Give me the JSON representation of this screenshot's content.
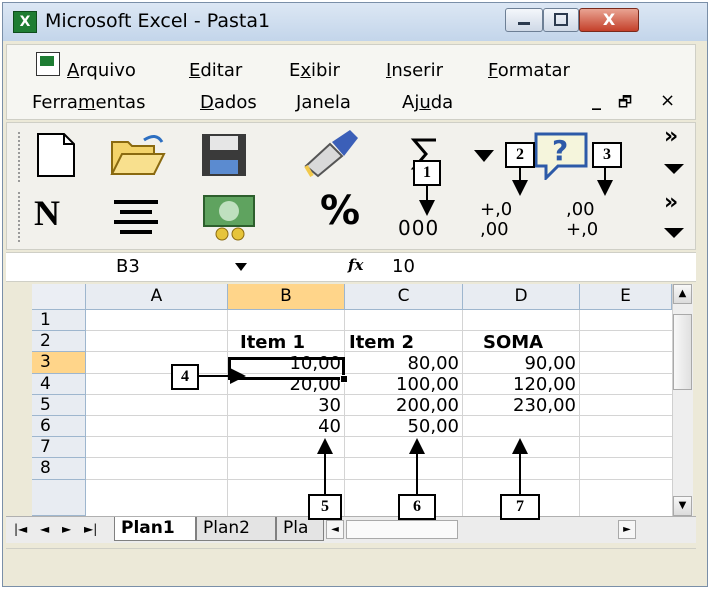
{
  "window": {
    "title": "Microsoft Excel - Pasta1",
    "close_glyph": "X"
  },
  "menu": {
    "row1": [
      {
        "pre": "",
        "u": "A",
        "post": "rquivo"
      },
      {
        "pre": "",
        "u": "E",
        "post": "ditar"
      },
      {
        "pre": "E",
        "u": "x",
        "post": "ibir"
      },
      {
        "pre": "",
        "u": "I",
        "post": "nserir"
      },
      {
        "pre": "",
        "u": "F",
        "post": "ormatar"
      }
    ],
    "row2": [
      {
        "pre": "Ferra",
        "u": "m",
        "post": "entas"
      },
      {
        "pre": "",
        "u": "D",
        "post": "ados"
      },
      {
        "pre": "",
        "u": "J",
        "post": "anela"
      },
      {
        "pre": "Aj",
        "u": "u",
        "post": "da"
      }
    ],
    "doc_controls": [
      "_",
      "🗗",
      "×"
    ]
  },
  "toolbar": {
    "bold_label": "N",
    "percent_label": "%",
    "thousands_label": "000",
    "inc_dec_top": "+,0",
    "inc_dec_bottom": ",00",
    "dec_dec_top": ",00",
    "dec_dec_bottom": "+,0",
    "more": "»"
  },
  "formula_bar": {
    "name_box": "B3",
    "fx": "fx",
    "value": "10"
  },
  "sheet": {
    "columns": [
      "A",
      "B",
      "C",
      "D",
      "E"
    ],
    "rows": [
      "1",
      "2",
      "3",
      "4",
      "5",
      "6",
      "7",
      "8"
    ],
    "selected_column": "B",
    "selected_row": "3",
    "cells": {
      "B2": "Item 1",
      "C2": "Item 2",
      "D2": "SOMA",
      "B3": "10,00",
      "C3": "80,00",
      "D3": "90,00",
      "B4": "20,00",
      "C4": "100,00",
      "D4": "120,00",
      "B5": "30",
      "C5": "200,00",
      "D5": "230,00",
      "B6": "40",
      "C6": "50,00"
    }
  },
  "tabs": {
    "nav": [
      "|◄",
      "◄",
      "►",
      "►|"
    ],
    "sheets": [
      "Plan1",
      "Plan2",
      "Pla"
    ]
  },
  "annotations": [
    "1",
    "2",
    "3",
    "4",
    "5",
    "6",
    "7"
  ]
}
